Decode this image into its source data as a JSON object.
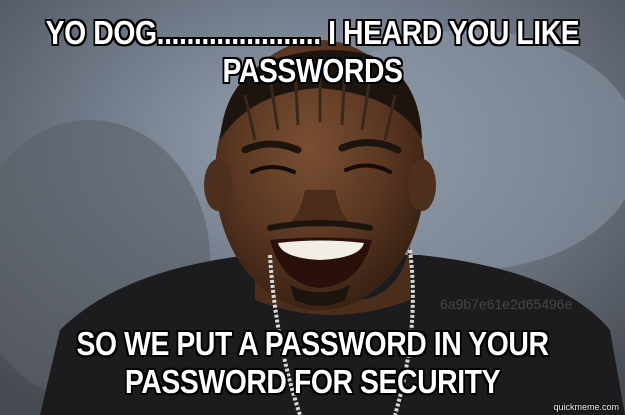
{
  "meme": {
    "top_text": "YO DOG...................... I HEARD YOU LIKE PASSWORDS",
    "bottom_text": "SO WE PUT A PASSWORD IN YOUR PASSWORD FOR SECURITY",
    "watermark": "quickmeme.com",
    "faint_id": "6a9b7e61e2d65496e"
  },
  "colors": {
    "caption_fill": "#ffffff",
    "caption_outline": "#000000",
    "background_top": "#8a96a8",
    "shirt": "#1c1c1e",
    "skin": "#5a3a26"
  }
}
